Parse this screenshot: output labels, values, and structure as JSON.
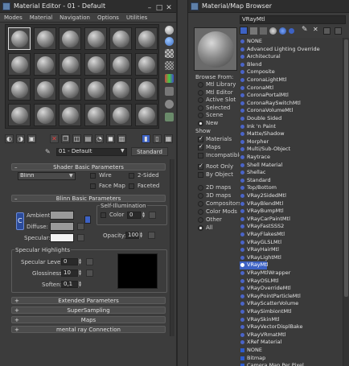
{
  "material_editor": {
    "title": "Material Editor - 01 - Default",
    "menu": [
      "Modes",
      "Material",
      "Navigation",
      "Options",
      "Utilities"
    ],
    "controls": [
      "–",
      "□",
      "✕"
    ],
    "material_name": "01 - Default",
    "material_type": "Standard",
    "rollouts": {
      "shader_basic": "Shader Basic Parameters",
      "blinn_basic": "Blinn Basic Parameters",
      "extended": "Extended Parameters",
      "supersampling": "SuperSampling",
      "maps": "Maps",
      "mental_ray": "mental ray Connection"
    },
    "shader": {
      "type": "Blinn",
      "wire_label": "Wire",
      "two_sided_label": "2-Sided",
      "face_map_label": "Face Map",
      "faceted_label": "Faceted"
    },
    "blinn": {
      "self_illum_label": "Self-Illumination",
      "color_label": "Color",
      "color_value": "0",
      "ambient_label": "Ambient:",
      "diffuse_label": "Diffuse:",
      "specular_label": "Specular:",
      "opacity_label": "Opacity:",
      "opacity_value": "100",
      "lock_label": "C"
    },
    "specular_highlights": {
      "title": "Specular Highlights",
      "level_label": "Specular Level:",
      "level_value": "0",
      "gloss_label": "Glossiness:",
      "gloss_value": "10",
      "soften_label": "Soften:",
      "soften_value": "0,1"
    },
    "rollout_signs": {
      "minus": "–",
      "plus": "+"
    }
  },
  "browser": {
    "title": "Material/Map Browser",
    "search_value": "VRayMtl",
    "browse_from": {
      "title": "Browse From:",
      "options": [
        "Mtl Library",
        "Mtl Editor",
        "Active Slot",
        "Selected",
        "Scene",
        "New"
      ],
      "selected_index": 5
    },
    "show": {
      "title": "Show",
      "options": [
        {
          "label": "Materials",
          "checked": true
        },
        {
          "label": "Maps",
          "checked": true
        },
        {
          "label": "Incompatible",
          "checked": false
        }
      ]
    },
    "root_only": [
      {
        "label": "Root Only",
        "checked": true
      },
      {
        "label": "By Object",
        "checked": false
      }
    ],
    "map_types": {
      "options": [
        "2D maps",
        "3D maps",
        "Compositors",
        "Color Mods",
        "Other",
        "All"
      ],
      "selected_index": 5
    },
    "list": [
      "NONE",
      "Advanced Lighting Override",
      "Architectural",
      "Blend",
      "Composite",
      "CoronaLightMtl",
      "CoronaMtl",
      "CoronaPortalMtl",
      "CoronaRaySwitchMtl",
      "CoronaVolumeMtl",
      "Double Sided",
      "Ink 'n Paint",
      "Matte/Shadow",
      "Morpher",
      "Multi/Sub-Object",
      "Raytrace",
      "Shell Material",
      "Shellac",
      "Standard",
      "Top/Bottom",
      "VRay2SidedMtl",
      "VRayBlendMtl",
      "VRayBumpMtl",
      "VRayCarPaintMtl",
      "VRayFastSSS2",
      "VRayFlakesMtl",
      "VRayGLSLMtl",
      "VRayHairMtl",
      "VRayLightMtl",
      "VRayMtl",
      "VRayMtlWrapper",
      "VRayOSLMtl",
      "VRayOverrideMtl",
      "VRayPointParticleMtl",
      "VRayScatterVolume",
      "VRaySimbiontMtl",
      "VRaySkinMtl",
      "VRayVectorDisplBake",
      "VRayVRmatMtl",
      "XRef Material",
      "NONE",
      "Bitmap",
      "Camera Map Per Pixel"
    ],
    "highlighted_index": 29
  },
  "colors": {
    "accent": "#3d62c4",
    "dot": "#4a64c8",
    "bg": "#3a3a3a",
    "title_bg": "#2d2d2d"
  }
}
